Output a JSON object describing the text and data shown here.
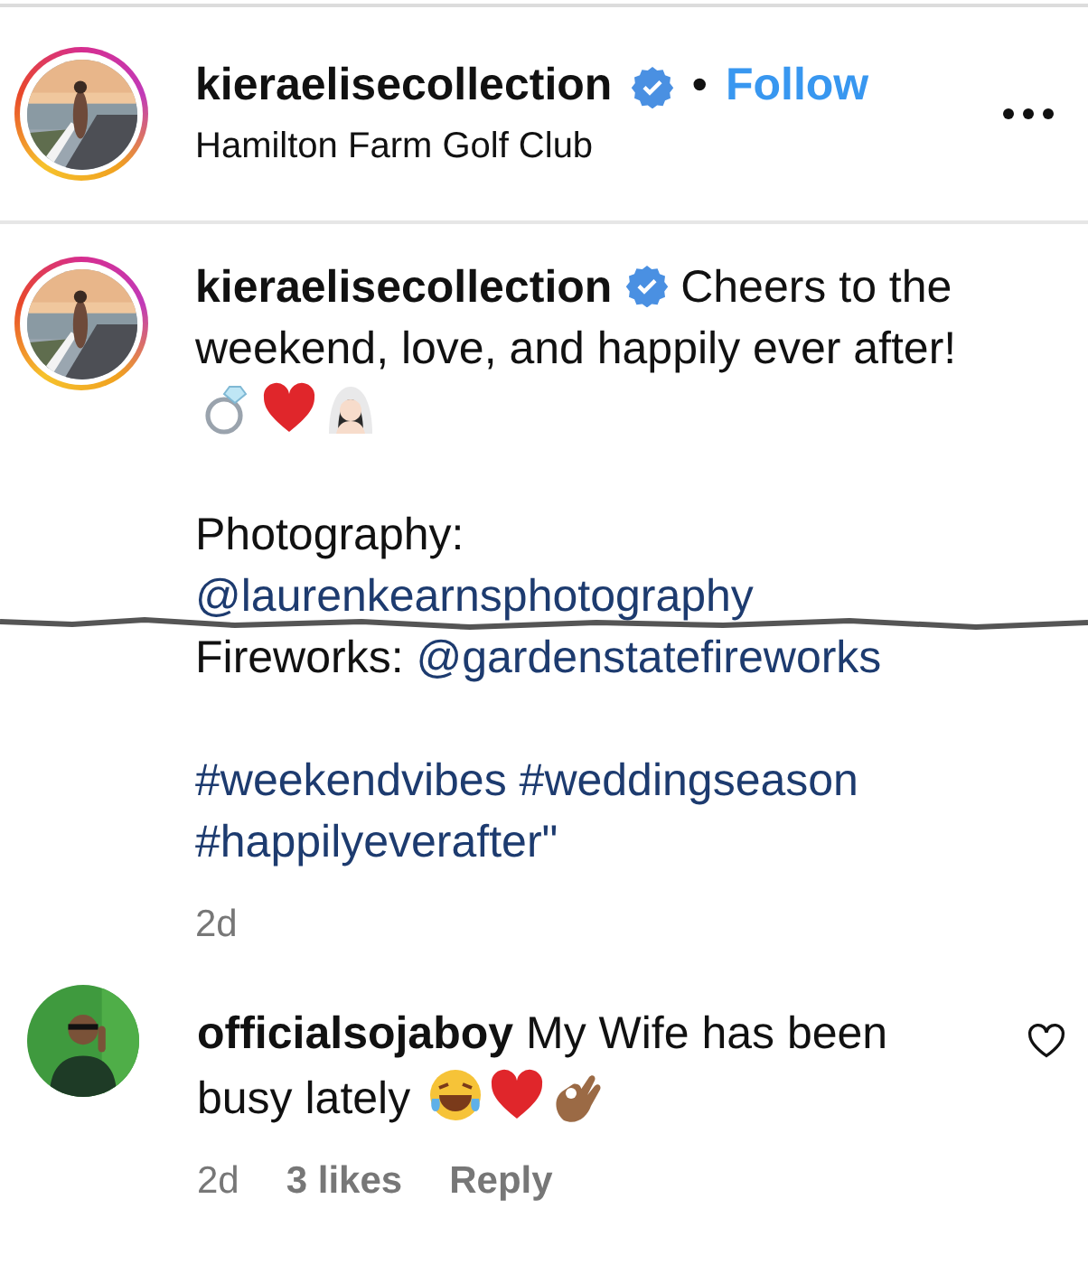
{
  "header": {
    "username": "kieraelisecollection",
    "verified": true,
    "separator": "•",
    "follow": "Follow",
    "location": "Hamilton Farm Golf Club"
  },
  "caption": {
    "username": "kieraelisecollection",
    "verified": true,
    "text": "Cheers to the weekend, love, and happily ever after!",
    "credits": [
      {
        "label": "Photography:",
        "handle": "@laurenkearnsphotography"
      },
      {
        "label": "Fireworks:",
        "handle": "@gardenstatefireworks"
      }
    ],
    "hashtags": "#weekendvibes #weddingseason #happilyeverafter\"",
    "time": "2d"
  },
  "comment": {
    "username": "officialsojaboy",
    "text": "My Wife has been busy lately",
    "time": "2d",
    "likes": "3 likes",
    "reply": "Reply",
    "liked": false
  }
}
